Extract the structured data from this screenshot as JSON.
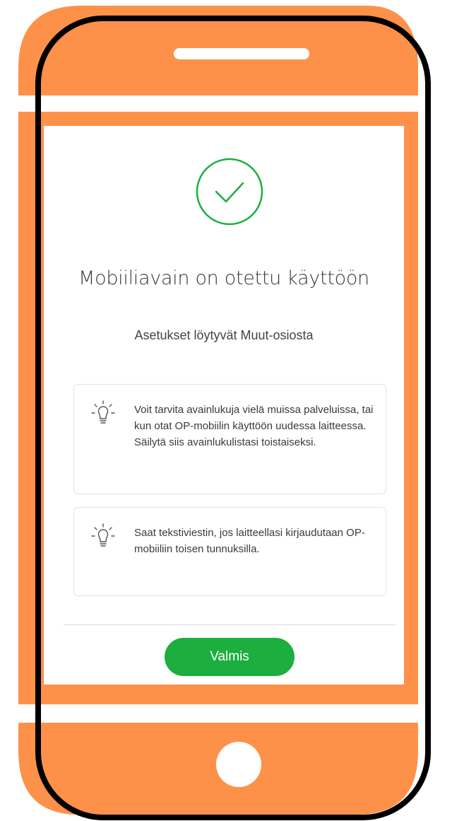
{
  "colors": {
    "phone_body": "#fe914a",
    "phone_outline": "#000000",
    "success_green": "#1cae3e",
    "text_dark": "#3a3a3a"
  },
  "icons": {
    "status": "check-circle-icon",
    "tip": "lightbulb-icon"
  },
  "success": {
    "title": "Mobiiliavain on otettu käyttöön",
    "subtitle": "Asetukset löytyvät Muut-osiosta"
  },
  "tips": [
    {
      "text": "Voit tarvita avainlukuja vielä muissa palveluissa, tai kun otat OP-mobiilin käyttöön uudessa laitteessa. Säilytä siis avainlukulistasi toistaiseksi."
    },
    {
      "text": "Saat tekstiviestin, jos laitteellasi kirjaudutaan OP-mobiiliin toisen tunnuksilla."
    }
  ],
  "actions": {
    "done_label": "Valmis"
  }
}
